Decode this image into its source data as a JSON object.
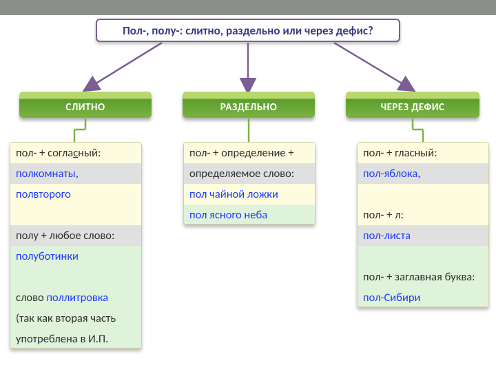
{
  "title": "Пол-, полу-: слитно, раздельно или через дефис?",
  "categories": [
    {
      "label": "СЛИТНО"
    },
    {
      "label": "РАЗДЕЛЬНО"
    },
    {
      "label": "ЧЕРЕЗ ДЕФИС"
    }
  ],
  "box0": {
    "r0a": "пол- + согла",
    "r0b": "с",
    "r0c": "ный:",
    "r1": "полкомнаты",
    "r1b": ",",
    "r2": "полвторого",
    "r3": "",
    "r4": "полу + любое слово:",
    "r5": "полуботинки",
    "r6": "",
    "r7a": "слово ",
    "r7b": "поллитровка",
    "r8": "(так как вторая часть",
    "r9": "употреблена в И.П."
  },
  "box1": {
    "r0": "пол- + определение +",
    "r1": "определяемое слово:",
    "r2": "пол чайной ложки",
    "r3": "пол ясного неба"
  },
  "box2": {
    "r0": "пол- + гласный:",
    "r1": "пол-яблока",
    "r1b": ",",
    "r2": "",
    "r3": "пол- + л:",
    "r4": "пол-листа",
    "r5": "",
    "r6": "пол- + заглавная буква:",
    "r7": "пол-Сибири"
  }
}
